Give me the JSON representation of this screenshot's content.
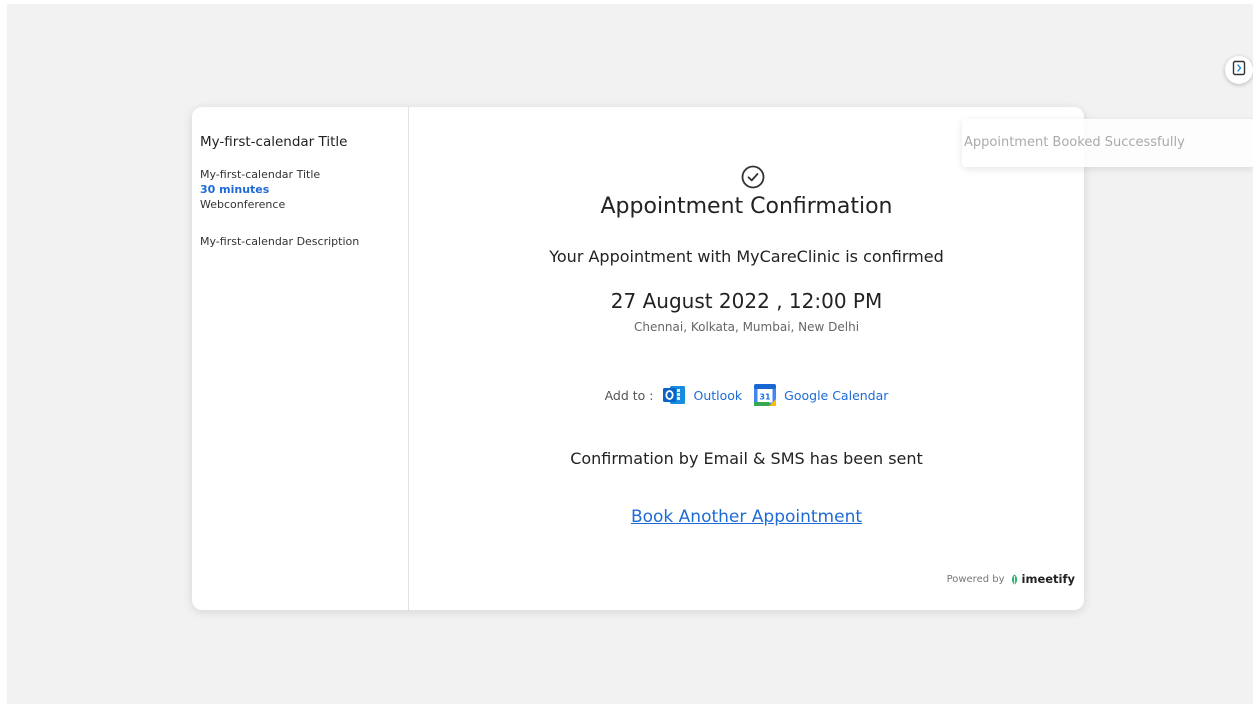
{
  "sidebar": {
    "title": "My-first-calendar Title",
    "event_title": "My-first-calendar Title",
    "duration": "30 minutes",
    "location_type": "Webconference",
    "description": "My-first-calendar Description"
  },
  "confirmation": {
    "icon": "check-circle-icon",
    "heading": "Appointment Confirmation",
    "message": "Your Appointment with MyCareClinic is confirmed",
    "datetime": "27 August 2022 , 12:00 PM",
    "timezone": "Chennai, Kolkata, Mumbai, New Delhi",
    "add_to_label": "Add to :",
    "calendars": [
      {
        "label": "Outlook",
        "icon": "outlook-icon"
      },
      {
        "label": "Google Calendar",
        "icon": "google-calendar-icon"
      }
    ],
    "sent_message": "Confirmation by Email & SMS has been sent",
    "book_another_label": "Book Another Appointment"
  },
  "footer": {
    "powered_by_label": "Powered by",
    "brand": "imeetify"
  },
  "toast": {
    "message": "Appointment Booked Successfully"
  },
  "corner_button": {
    "icon": "document-icon"
  },
  "colors": {
    "link": "#1e6bd8",
    "background": "#f2f2f2",
    "outlook": "#0a64c8",
    "brand_leaf": "#2bb673"
  }
}
